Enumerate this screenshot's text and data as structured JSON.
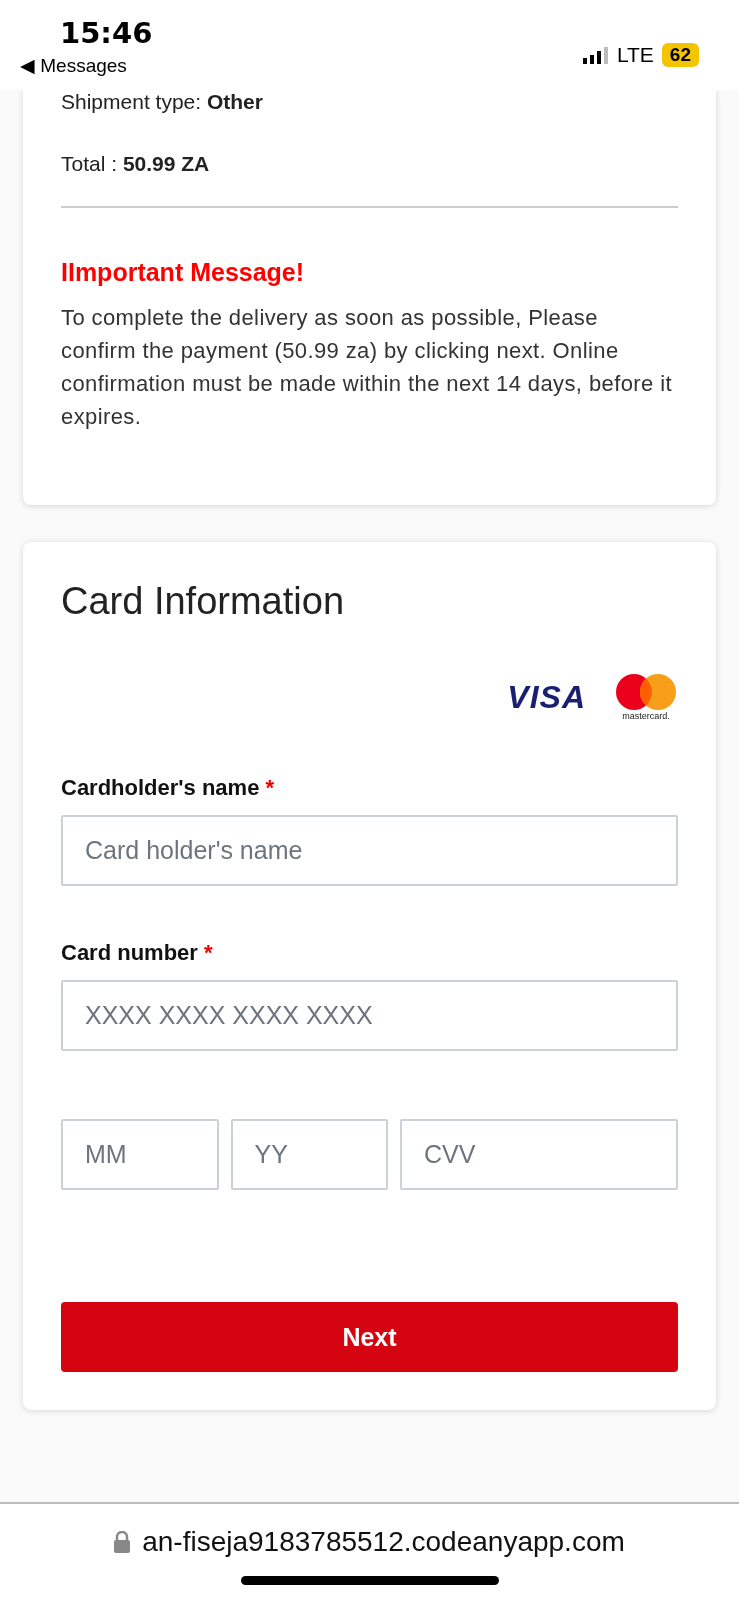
{
  "status_bar": {
    "time": "15:46",
    "back_label": "◀ Messages",
    "network": "LTE",
    "battery": "62"
  },
  "summary": {
    "shipment_label": "Shipment type:",
    "shipment_value": "Other",
    "total_label": "Total :",
    "total_value": "50.99 ZA"
  },
  "notice": {
    "title": "IImportant Message!",
    "body": "To complete the delivery as soon as possible, Please confirm the payment (50.99 za) by clicking next. Online confirmation must be made within the next 14 days, before it expires."
  },
  "card_form": {
    "title": "Card Information",
    "logos": {
      "visa": "VISA",
      "mastercard": "mastercard."
    },
    "fields": [
      {
        "label": "Cardholder's name",
        "required_mark": "*",
        "placeholder": "Card holder's name"
      },
      {
        "label": "Card number",
        "required_mark": "*",
        "placeholder": "XXXX XXXX XXXX XXXX"
      }
    ],
    "small_fields": [
      {
        "placeholder": "MM"
      },
      {
        "placeholder": "YY"
      },
      {
        "placeholder": "CVV"
      }
    ],
    "submit": "Next"
  },
  "browser_bar": {
    "url": "an-fiseja9183785512.codeanyapp.com"
  }
}
